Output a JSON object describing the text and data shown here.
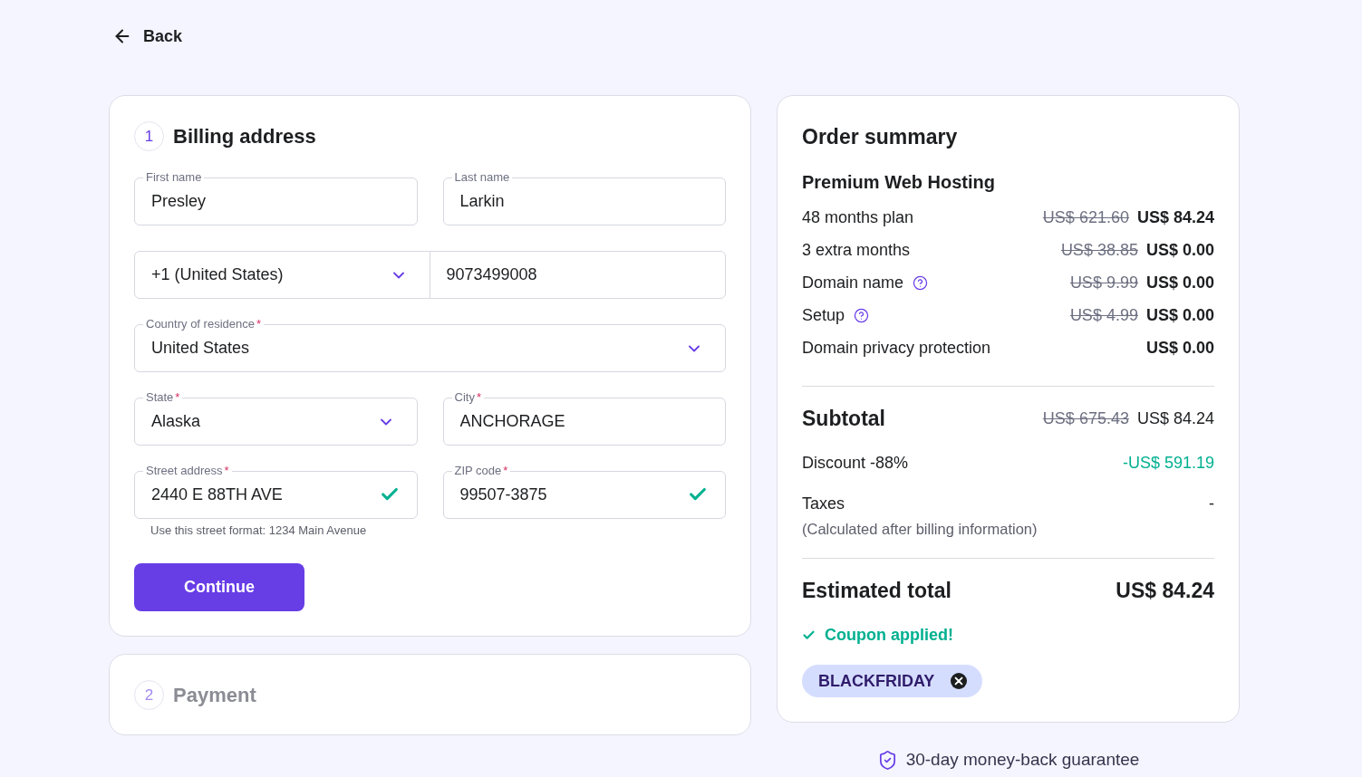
{
  "back_link": {
    "label": "Back"
  },
  "billing": {
    "step_number": "1",
    "title": "Billing address",
    "active": true,
    "rows": [
      {
        "joined": false,
        "fields": [
          {
            "kind": "text",
            "label": "First name",
            "value": "Presley",
            "valid": false
          },
          {
            "kind": "text",
            "label": "Last name",
            "value": "Larkin",
            "valid": false
          }
        ]
      },
      {
        "joined": true,
        "fields": [
          {
            "kind": "select",
            "value": "+1 (United States)"
          },
          {
            "kind": "text",
            "value": "9073499008",
            "valid": false
          }
        ]
      },
      {
        "fields": [
          {
            "kind": "select",
            "label": "Country of residence",
            "required_mark": "*",
            "value": "United States"
          }
        ]
      },
      {
        "joined": false,
        "fields": [
          {
            "kind": "select",
            "label": "State",
            "required_mark": "*",
            "value": "Alaska"
          },
          {
            "kind": "text",
            "label": "City",
            "required_mark": "*",
            "value": "ANCHORAGE",
            "valid": false
          }
        ]
      },
      {
        "joined": false,
        "fields": [
          {
            "kind": "text",
            "label": "Street address",
            "required_mark": "*",
            "value": "2440 E 88TH AVE",
            "valid": true,
            "hint": "Use this street format: 1234 Main Avenue"
          },
          {
            "kind": "text",
            "label": "ZIP code",
            "required_mark": "*",
            "value": "99507-3875",
            "valid": true
          }
        ]
      }
    ],
    "continue_button": "Continue"
  },
  "payment": {
    "step_number": "2",
    "title": "Payment",
    "active": false
  },
  "order_summary": {
    "title": "Order summary",
    "product": "Premium Web Hosting",
    "items": [
      {
        "label": "48 months plan",
        "help": false,
        "old_price": "US$ 621.60",
        "price": "US$ 84.24"
      },
      {
        "label": "3 extra months",
        "help": false,
        "old_price": "US$ 38.85",
        "price": "US$ 0.00"
      },
      {
        "label": "Domain name",
        "help": true,
        "old_price": "US$ 9.99",
        "price": "US$ 0.00"
      },
      {
        "label": "Setup",
        "help": true,
        "old_price": "US$ 4.99",
        "price": "US$ 0.00"
      },
      {
        "label": "Domain privacy protection",
        "help": false,
        "price": "US$ 0.00"
      }
    ],
    "subtotal": {
      "label": "Subtotal",
      "old_price": "US$ 675.43",
      "price": "US$ 84.24"
    },
    "discount": {
      "label": "Discount -88%",
      "amount": "-US$ 591.19"
    },
    "taxes": {
      "label": "Taxes",
      "note": "(Calculated after billing information)",
      "amount": "-"
    },
    "total": {
      "label": "Estimated total",
      "amount": "US$ 84.24"
    },
    "coupon": {
      "status": "Coupon applied!",
      "code": "BLACKFRIDAY"
    }
  },
  "guarantee": "30-day money-back guarantee"
}
